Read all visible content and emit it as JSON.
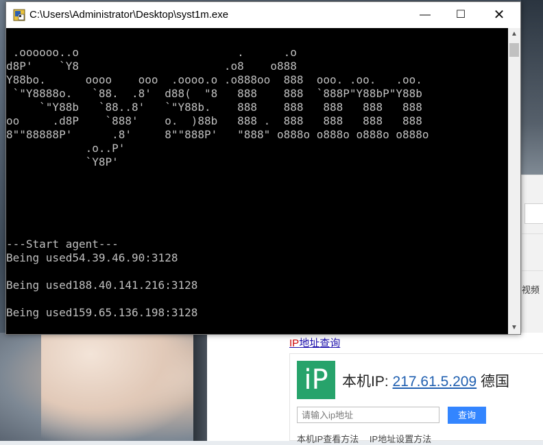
{
  "console": {
    "title": "C:\\Users\\Administrator\\Desktop\\syst1m.exe",
    "lines": [
      "",
      " .oooooo..o                        .      .o",
      "d8P'    `Y8                      .o8    o888",
      "Y88bo.      oooo    ooo  .oooo.o .o888oo  888  ooo. .oo.   .oo.",
      " `\"Y8888o.   `88.  .8'  d88(  \"8   888    888  `888P\"Y88bP\"Y88b",
      "     `\"Y88b   `88..8'   `\"Y88b.    888    888   888   888   888",
      "oo     .d8P    `888'    o.  )88b   888 .  888   888   888   888",
      "8\"\"88888P'      .8'     8\"\"888P'   \"888\" o888o o888o o888o o888o",
      "            .o..P'",
      "            `Y8P'",
      "",
      "",
      "",
      "",
      "",
      "---Start agent---",
      "Being used54.39.46.90:3128",
      "",
      "Being used188.40.141.216:3128",
      "",
      "Being used159.65.136.198:3128"
    ],
    "minimize_symbol": "—",
    "maximize_symbol": "☐",
    "close_symbol": "✕",
    "scroll_up_symbol": "▲",
    "scroll_down_symbol": "▼"
  },
  "browser": {
    "side_fragment": "视频",
    "ip_link_red": "IP",
    "ip_link_rest": "地址查询",
    "logo_text": "iP",
    "ip_label": "本机IP:",
    "ip_value": "217.61.5.209",
    "ip_country": "德国",
    "input_placeholder": "请输入ip地址",
    "query_button": "查询",
    "link_view_method": "本机IP查看方法",
    "link_set_method": "IP地址设置方法"
  },
  "colors": {
    "console_bg": "#000000",
    "console_fg": "#c0c0c0",
    "logo_green": "#27a36b",
    "query_blue": "#3385ff",
    "ip_blue": "#1f5fb0"
  }
}
